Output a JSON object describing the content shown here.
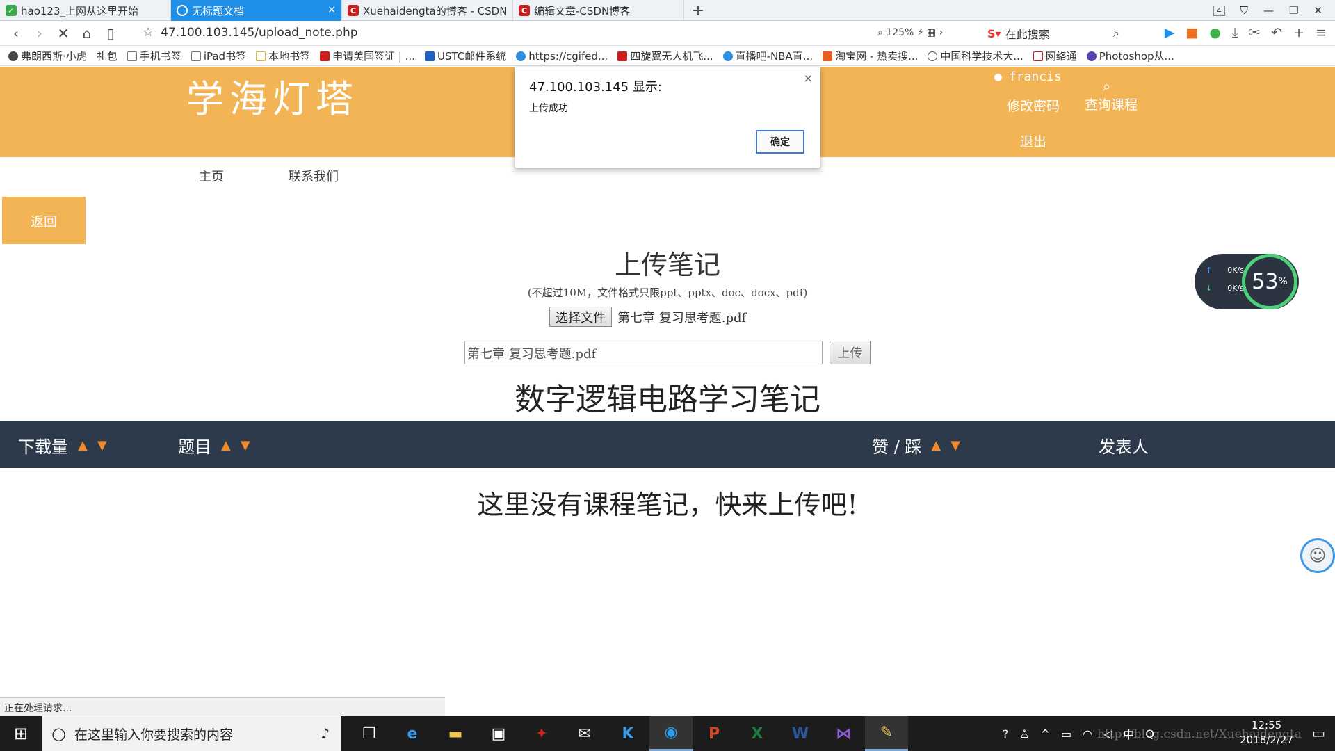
{
  "browser": {
    "tabs": [
      {
        "label": "hao123_上网从这里开始",
        "favicon": "hao123-icon",
        "color": "#3aa84b"
      },
      {
        "label": "无标题文档",
        "favicon": "loading-icon",
        "color": "#ffffff",
        "active": true
      },
      {
        "label": "Xuehaidengta的博客 - CSDN",
        "favicon": "csdn-icon",
        "color": "#c91f1f"
      },
      {
        "label": "编辑文章-CSDN博客",
        "favicon": "csdn-icon",
        "color": "#c91f1f"
      }
    ],
    "tab_count": "4",
    "url": "47.100.103.145/upload_note.php",
    "zoom": "125%",
    "search_placeholder": "在此搜索",
    "bookmarks": [
      {
        "label": "弗朗西斯·小虎",
        "color": "#444"
      },
      {
        "label": "礼包",
        "color": "#e0a030"
      },
      {
        "label": "手机书签",
        "color": "#777"
      },
      {
        "label": "iPad书签",
        "color": "#777"
      },
      {
        "label": "本地书签",
        "color": "#e6b422"
      },
      {
        "label": "申请美国签证 | ...",
        "color": "#c91f1f"
      },
      {
        "label": "USTC邮件系统",
        "color": "#1f5fbf"
      },
      {
        "label": "https://cgifed...",
        "color": "#2a8de0"
      },
      {
        "label": "四旋翼无人机飞...",
        "color": "#c91f1f"
      },
      {
        "label": "直播吧-NBA直...",
        "color": "#2a8de0"
      },
      {
        "label": "淘宝网 - 热卖搜...",
        "color": "#e95c20"
      },
      {
        "label": "中国科学技术大...",
        "color": "#555"
      },
      {
        "label": "网络通",
        "color": "#c91f1f"
      },
      {
        "label": "Photoshop从...",
        "color": "#5a3fb0"
      }
    ],
    "status": "正在处理请求..."
  },
  "site": {
    "logo": "学海灯塔",
    "user": "francis",
    "change_password": "修改密码",
    "search_course": "查询课程",
    "logout": "退出",
    "nav_home": "主页",
    "nav_contact": "联系我们",
    "back": "返回",
    "upload_title": "上传笔记",
    "upload_hint": "(不超过10M，文件格式只限ppt、pptx、doc、docx、pdf)",
    "choose_file": "选择文件",
    "chosen_file": "第七章 复习思考题.pdf",
    "filename_value": "第七章 复习思考题.pdf",
    "upload_btn": "上传",
    "course_title": "数字逻辑电路学习笔记",
    "col_downloads": "下载量",
    "col_title": "题目",
    "col_votes": "赞 / 踩",
    "col_author": "发表人",
    "empty": "这里没有课程笔记，快来上传吧!"
  },
  "dialog": {
    "title": "47.100.103.145 显示:",
    "message": "上传成功",
    "ok": "确定"
  },
  "net_widget": {
    "up": "0K/s",
    "down": "0K/s",
    "percent": "53",
    "unit": "%"
  },
  "taskbar": {
    "search_placeholder": "在这里输入你要搜索的内容",
    "time": "12:55",
    "date": "2018/2/27",
    "ime": "中"
  },
  "watermark": "http://blog.csdn.net/Xuehaidengta"
}
